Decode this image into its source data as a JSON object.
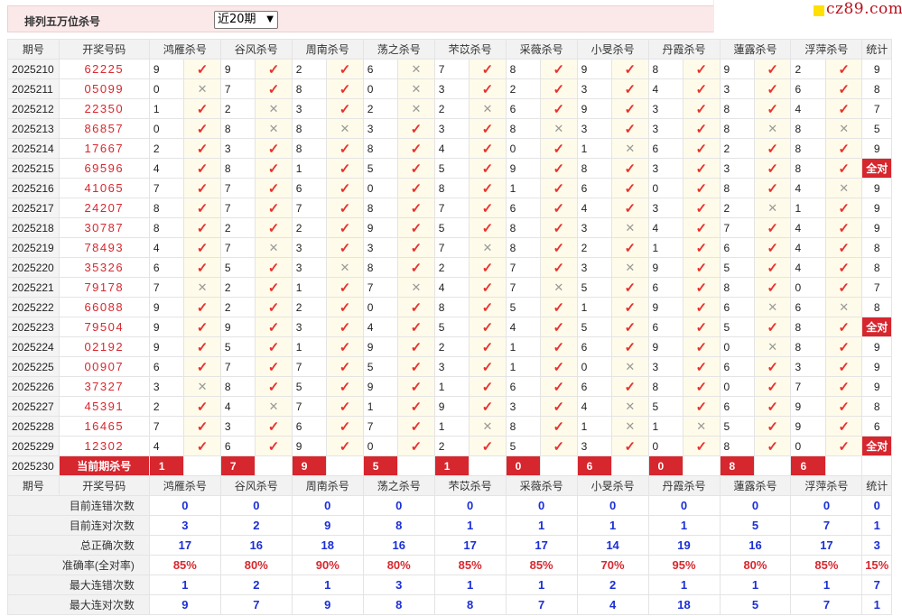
{
  "page": {
    "title": "排列五万位杀号",
    "period_select": "近20期",
    "logo": "cz89.com"
  },
  "table": {
    "headers": [
      "期号",
      "开奖号码",
      "鸿雁杀号",
      "谷风杀号",
      "周南杀号",
      "荡之杀号",
      "芣苡杀号",
      "采薇杀号",
      "小旻杀号",
      "丹霞杀号",
      "蓮露杀号",
      "浮萍杀号",
      "统计"
    ],
    "rows": [
      {
        "period": "2025210",
        "draw": "62225",
        "kills": [
          9,
          9,
          2,
          6,
          7,
          8,
          9,
          8,
          9,
          2
        ],
        "marks": [
          1,
          1,
          1,
          0,
          1,
          1,
          1,
          1,
          1,
          1
        ],
        "stat": "9"
      },
      {
        "period": "2025211",
        "draw": "05099",
        "kills": [
          0,
          7,
          8,
          0,
          3,
          2,
          3,
          4,
          3,
          6
        ],
        "marks": [
          0,
          1,
          1,
          0,
          1,
          1,
          1,
          1,
          1,
          1
        ],
        "stat": "8"
      },
      {
        "period": "2025212",
        "draw": "22350",
        "kills": [
          1,
          2,
          3,
          2,
          2,
          6,
          9,
          3,
          8,
          4
        ],
        "marks": [
          1,
          0,
          1,
          0,
          0,
          1,
          1,
          1,
          1,
          1
        ],
        "stat": "7"
      },
      {
        "period": "2025213",
        "draw": "86857",
        "kills": [
          0,
          8,
          8,
          3,
          3,
          8,
          3,
          3,
          8,
          8
        ],
        "marks": [
          1,
          0,
          0,
          1,
          1,
          0,
          1,
          1,
          0,
          0
        ],
        "stat": "5"
      },
      {
        "period": "2025214",
        "draw": "17667",
        "kills": [
          2,
          3,
          8,
          8,
          4,
          0,
          1,
          6,
          2,
          8
        ],
        "marks": [
          1,
          1,
          1,
          1,
          1,
          1,
          0,
          1,
          1,
          1
        ],
        "stat": "9"
      },
      {
        "period": "2025215",
        "draw": "69596",
        "kills": [
          4,
          8,
          1,
          5,
          5,
          9,
          8,
          3,
          3,
          8
        ],
        "marks": [
          1,
          1,
          1,
          1,
          1,
          1,
          1,
          1,
          1,
          1
        ],
        "stat": "全对"
      },
      {
        "period": "2025216",
        "draw": "41065",
        "kills": [
          7,
          7,
          6,
          0,
          8,
          1,
          6,
          0,
          8,
          4
        ],
        "marks": [
          1,
          1,
          1,
          1,
          1,
          1,
          1,
          1,
          1,
          0
        ],
        "stat": "9"
      },
      {
        "period": "2025217",
        "draw": "24207",
        "kills": [
          8,
          7,
          7,
          8,
          7,
          6,
          4,
          3,
          2,
          1
        ],
        "marks": [
          1,
          1,
          1,
          1,
          1,
          1,
          1,
          1,
          0,
          1
        ],
        "stat": "9"
      },
      {
        "period": "2025218",
        "draw": "30787",
        "kills": [
          8,
          2,
          2,
          9,
          5,
          8,
          3,
          4,
          7,
          4
        ],
        "marks": [
          1,
          1,
          1,
          1,
          1,
          1,
          0,
          1,
          1,
          1
        ],
        "stat": "9"
      },
      {
        "period": "2025219",
        "draw": "78493",
        "kills": [
          4,
          7,
          3,
          3,
          7,
          8,
          2,
          1,
          6,
          4
        ],
        "marks": [
          1,
          0,
          1,
          1,
          0,
          1,
          1,
          1,
          1,
          1
        ],
        "stat": "8"
      },
      {
        "period": "2025220",
        "draw": "35326",
        "kills": [
          6,
          5,
          3,
          8,
          2,
          7,
          3,
          9,
          5,
          4
        ],
        "marks": [
          1,
          1,
          0,
          1,
          1,
          1,
          0,
          1,
          1,
          1
        ],
        "stat": "8"
      },
      {
        "period": "2025221",
        "draw": "79178",
        "kills": [
          7,
          2,
          1,
          7,
          4,
          7,
          5,
          6,
          8,
          0
        ],
        "marks": [
          0,
          1,
          1,
          0,
          1,
          0,
          1,
          1,
          1,
          1
        ],
        "stat": "7"
      },
      {
        "period": "2025222",
        "draw": "66088",
        "kills": [
          9,
          2,
          2,
          0,
          8,
          5,
          1,
          9,
          6,
          6
        ],
        "marks": [
          1,
          1,
          1,
          1,
          1,
          1,
          1,
          1,
          0,
          0
        ],
        "stat": "8"
      },
      {
        "period": "2025223",
        "draw": "79504",
        "kills": [
          9,
          9,
          3,
          4,
          5,
          4,
          5,
          6,
          5,
          8
        ],
        "marks": [
          1,
          1,
          1,
          1,
          1,
          1,
          1,
          1,
          1,
          1
        ],
        "stat": "全对"
      },
      {
        "period": "2025224",
        "draw": "02192",
        "kills": [
          9,
          5,
          1,
          9,
          2,
          1,
          6,
          9,
          0,
          8
        ],
        "marks": [
          1,
          1,
          1,
          1,
          1,
          1,
          1,
          1,
          0,
          1
        ],
        "stat": "9"
      },
      {
        "period": "2025225",
        "draw": "00907",
        "kills": [
          6,
          7,
          7,
          5,
          3,
          1,
          0,
          3,
          6,
          3
        ],
        "marks": [
          1,
          1,
          1,
          1,
          1,
          1,
          0,
          1,
          1,
          1
        ],
        "stat": "9"
      },
      {
        "period": "2025226",
        "draw": "37327",
        "kills": [
          3,
          8,
          5,
          9,
          1,
          6,
          6,
          8,
          0,
          7
        ],
        "marks": [
          0,
          1,
          1,
          1,
          1,
          1,
          1,
          1,
          1,
          1
        ],
        "stat": "9"
      },
      {
        "period": "2025227",
        "draw": "45391",
        "kills": [
          2,
          4,
          7,
          1,
          9,
          3,
          4,
          5,
          6,
          9
        ],
        "marks": [
          1,
          0,
          1,
          1,
          1,
          1,
          0,
          1,
          1,
          1
        ],
        "stat": "8"
      },
      {
        "period": "2025228",
        "draw": "16465",
        "kills": [
          7,
          3,
          6,
          7,
          1,
          8,
          1,
          1,
          5,
          9
        ],
        "marks": [
          1,
          1,
          1,
          1,
          0,
          1,
          0,
          0,
          1,
          1
        ],
        "stat": "6"
      },
      {
        "period": "2025229",
        "draw": "12302",
        "kills": [
          4,
          6,
          9,
          0,
          2,
          5,
          3,
          0,
          8,
          0
        ],
        "marks": [
          1,
          1,
          1,
          1,
          1,
          1,
          1,
          1,
          1,
          1
        ],
        "stat": "全对"
      }
    ],
    "current": {
      "period": "2025230",
      "label": "当前期杀号",
      "kills": [
        1,
        7,
        9,
        5,
        1,
        0,
        6,
        0,
        8,
        6
      ]
    },
    "stats": [
      {
        "label": "目前连错次数",
        "values": [
          "0",
          "0",
          "0",
          "0",
          "0",
          "0",
          "0",
          "0",
          "0",
          "0",
          "0"
        ],
        "color": "blue"
      },
      {
        "label": "目前连对次数",
        "values": [
          "3",
          "2",
          "9",
          "8",
          "1",
          "1",
          "1",
          "1",
          "5",
          "7",
          "1"
        ],
        "color": "blue"
      },
      {
        "label": "总正确次数",
        "values": [
          "17",
          "16",
          "18",
          "16",
          "17",
          "17",
          "14",
          "19",
          "16",
          "17",
          "3"
        ],
        "color": "blue"
      },
      {
        "label": "准确率(全对率)",
        "values": [
          "85%",
          "80%",
          "90%",
          "80%",
          "85%",
          "85%",
          "70%",
          "95%",
          "80%",
          "85%",
          "15%"
        ],
        "color": "red"
      },
      {
        "label": "最大连错次数",
        "values": [
          "1",
          "2",
          "1",
          "3",
          "1",
          "1",
          "2",
          "1",
          "1",
          "1",
          "7"
        ],
        "color": "blue"
      },
      {
        "label": "最大连对次数",
        "values": [
          "9",
          "7",
          "9",
          "8",
          "8",
          "7",
          "4",
          "18",
          "5",
          "7",
          "1"
        ],
        "color": "blue"
      }
    ],
    "mark_symbols": {
      "correct": "✓",
      "wrong": "✕"
    }
  },
  "colors": {
    "accent_red": "#d6262e",
    "stat_blue": "#1b2fd6",
    "header_bg": "#f2f2f2",
    "topbar_bg": "#fbe9ea"
  }
}
